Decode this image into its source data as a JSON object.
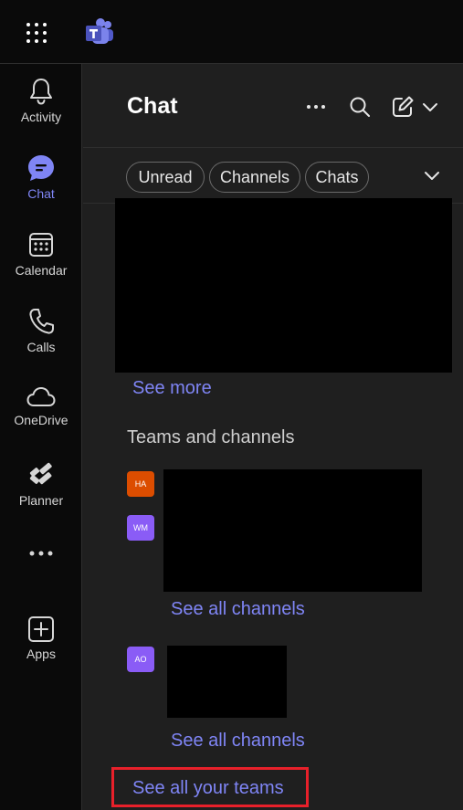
{
  "rail": {
    "items": [
      {
        "label": "Activity",
        "icon": "bell-icon",
        "active": false
      },
      {
        "label": "Chat",
        "icon": "chat-icon",
        "active": true
      },
      {
        "label": "Calendar",
        "icon": "calendar-icon",
        "active": false
      },
      {
        "label": "Calls",
        "icon": "phone-icon",
        "active": false
      },
      {
        "label": "OneDrive",
        "icon": "cloud-icon",
        "active": false
      },
      {
        "label": "Planner",
        "icon": "planner-icon",
        "active": false
      },
      {
        "label": "Apps",
        "icon": "add-app-icon",
        "active": false
      }
    ],
    "more_icon": "more-icon"
  },
  "header": {
    "title": "Chat",
    "icons": [
      "more-options-icon",
      "search-icon",
      "new-chat-icon",
      "chevron-down-icon"
    ]
  },
  "filters": {
    "pills": [
      "Unread",
      "Channels",
      "Chats"
    ],
    "expand_icon": "chevron-down-icon"
  },
  "chats": {
    "see_more": "See more"
  },
  "teams": {
    "section_title": "Teams and channels",
    "groups": [
      {
        "avatars": [
          {
            "initials": "HA",
            "color": "#dc4d00"
          },
          {
            "initials": "WM",
            "color": "#8a5cf6"
          }
        ],
        "see_all_channels": "See all channels"
      },
      {
        "avatars": [
          {
            "initials": "AO",
            "color": "#8a5cf6"
          }
        ],
        "see_all_channels": "See all channels"
      }
    ],
    "see_all_teams": "See all your teams"
  },
  "colors": {
    "accent": "#7f85f5",
    "highlight": "#e8202a",
    "background": "#1f1f1f",
    "rail_background": "#0a0a0a"
  }
}
